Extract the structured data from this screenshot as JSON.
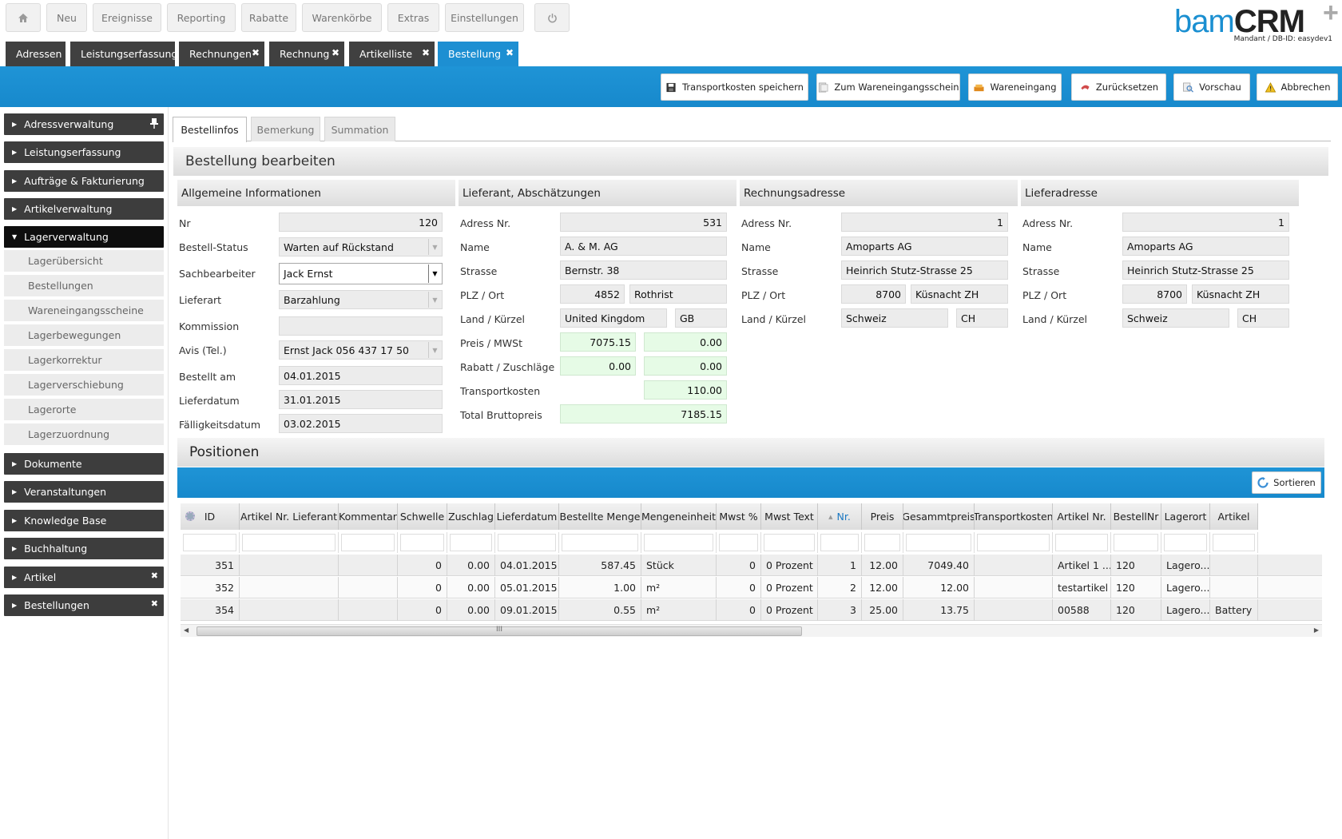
{
  "topnav": {
    "home": "home-icon",
    "items": [
      "Neu",
      "Ereignisse",
      "Reporting",
      "Rabatte",
      "Warenkörbe",
      "Extras",
      "Einstellungen"
    ],
    "power": "power-icon"
  },
  "logo": {
    "brand_light": "bam",
    "brand_bold": "CRM",
    "plus": "+",
    "subtitle": "Mandant / DB-ID: easydev1"
  },
  "window_tabs": [
    {
      "label": "Adressen"
    },
    {
      "label": "Leistungserfassung"
    },
    {
      "label": "Rechnungen",
      "close": "✖"
    },
    {
      "label": "Rechnung",
      "close": "✖"
    },
    {
      "label": "Artikelliste",
      "close": "✖"
    },
    {
      "label": "Bestellung",
      "close": "✖"
    }
  ],
  "actions": [
    "Transportkosten speichern",
    "Zum Wareneingangsschein",
    "Wareneingang",
    "Zurücksetzen",
    "Vorschau",
    "Abbrechen"
  ],
  "sidebar": {
    "groups": [
      "Adressverwaltung",
      "Leistungserfassung",
      "Aufträge & Fakturierung",
      "Artikelverwaltung",
      "Lagerverwaltung",
      "Dokumente",
      "Veranstaltungen",
      "Knowledge Base",
      "Buchhaltung",
      "Artikel",
      "Bestellungen"
    ],
    "sub_items": [
      "Lagerübersicht",
      "Bestellungen",
      "Wareneingangsscheine",
      "Lagerbewegungen",
      "Lagerkorrektur",
      "Lagerverschiebung",
      "Lagerorte",
      "Lagerzuordnung"
    ]
  },
  "content_tabs": [
    "Bestellinfos",
    "Bemerkung",
    "Summation"
  ],
  "section_title": "Bestellung bearbeiten",
  "allgemein": {
    "title": "Allgemeine Informationen",
    "labels": [
      "Nr",
      "Bestell-Status",
      "Sachbearbeiter",
      "Lieferart",
      "Kommission",
      "Avis (Tel.)",
      "Bestellt am",
      "Lieferdatum",
      "Fälligkeitsdatum"
    ],
    "values": {
      "nr": "120",
      "status": "Warten auf Rückstand",
      "sachbearbeiter": "Jack Ernst",
      "lieferart": "Barzahlung",
      "kommission": "",
      "avis": "Ernst Jack 056 437 17 50",
      "bestellt_am": "04.01.2015",
      "lieferdatum": "31.01.2015",
      "faelligkeit": "03.02.2015"
    }
  },
  "lieferant": {
    "title": "Lieferant, Abschätzungen",
    "labels": [
      "Adress Nr.",
      "Name",
      "Strasse",
      "PLZ / Ort",
      "Land / Kürzel",
      "Preis / MWSt",
      "Rabatt / Zuschläge",
      "Transportkosten",
      "Total Bruttopreis"
    ],
    "values": {
      "adress_nr": "531",
      "name": "A. & M.  AG",
      "strasse": "Bernstr. 38",
      "plz": "4852",
      "ort": "Rothrist",
      "land": "United Kingdom",
      "kuerzel": "GB",
      "preis": "7075.15",
      "mwst": "0.00",
      "rabatt": "0.00",
      "zuschlaege": "0.00",
      "transportkosten": "110.00",
      "total": "7185.15"
    }
  },
  "rechnungsadresse": {
    "title": "Rechnungsadresse",
    "labels": [
      "Adress Nr.",
      "Name",
      "Strasse",
      "PLZ / Ort",
      "Land / Kürzel"
    ],
    "values": {
      "adress_nr": "1",
      "name": "Amoparts AG",
      "strasse": "Heinrich Stutz-Strasse 25",
      "plz": "8700",
      "ort": "Küsnacht ZH",
      "land": "Schweiz",
      "kuerzel": "CH"
    }
  },
  "lieferadresse": {
    "title": "Lieferadresse",
    "labels": [
      "Adress Nr.",
      "Name",
      "Strasse",
      "PLZ / Ort",
      "Land / Kürzel"
    ],
    "values": {
      "adress_nr": "1",
      "name": "Amoparts AG",
      "strasse": "Heinrich Stutz-Strasse 25",
      "plz": "8700",
      "ort": "Küsnacht ZH",
      "land": "Schweiz",
      "kuerzel": "CH"
    }
  },
  "positionen": {
    "title": "Positionen",
    "sort_label": "Sortieren",
    "columns": [
      "ID",
      "Artikel Nr. Lieferant",
      "Kommentar",
      "Schwelle",
      "Zuschlag",
      "Lieferdatum",
      "Bestellte Menge",
      "Mengeneinheit",
      "Mwst %",
      "Mwst Text",
      "Nr.",
      "Preis",
      "Gesammtpreis",
      "Transportkosten",
      "Artikel Nr.",
      "BestellNr",
      "Lagerort",
      "Artikel"
    ],
    "sorted_column_marker": "▲",
    "rows": [
      [
        "351",
        "",
        "",
        "0",
        "0.00",
        "04.01.2015...",
        "587.45",
        "Stück",
        "0",
        "0 Prozent",
        "1",
        "12.00",
        "7049.40",
        "",
        "Artikel 1 ...",
        "120",
        "Lagero...",
        ""
      ],
      [
        "352",
        "",
        "",
        "0",
        "0.00",
        "05.01.2015...",
        "1.00",
        "m²",
        "0",
        "0 Prozent",
        "2",
        "12.00",
        "12.00",
        "",
        "testartikel",
        "120",
        "Lagero...",
        ""
      ],
      [
        "354",
        "",
        "",
        "0",
        "0.00",
        "09.01.2015...",
        "0.55",
        "m²",
        "0",
        "0 Prozent",
        "3",
        "25.00",
        "13.75",
        "",
        "00588",
        "120",
        "Lagero...",
        "Battery"
      ]
    ],
    "scroll_grip": "III"
  }
}
